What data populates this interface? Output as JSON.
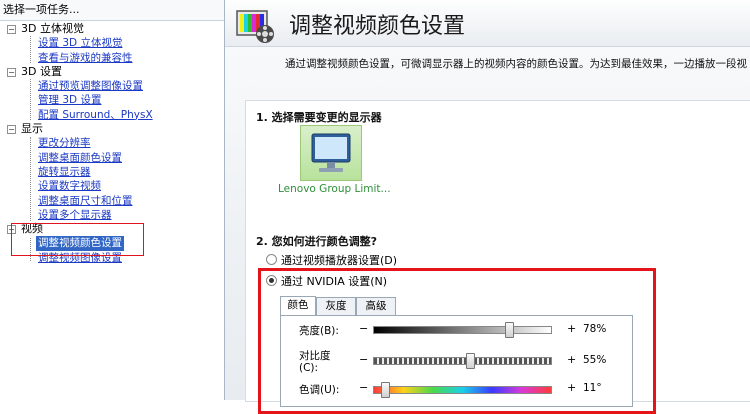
{
  "task_pane": {
    "header": "选择一项任务...",
    "categories": [
      {
        "label": "3D 立体视觉",
        "items": [
          "设置 3D 立体视觉",
          "查看与游戏的兼容性"
        ]
      },
      {
        "label": "3D 设置",
        "items": [
          "通过预览调整图像设置",
          "管理 3D 设置",
          "配置 Surround、PhysX"
        ]
      },
      {
        "label": "显示",
        "items": [
          "更改分辨率",
          "调整桌面颜色设置",
          "旋转显示器",
          "设置数字视频",
          "调整桌面尺寸和位置",
          "设置多个显示器"
        ]
      },
      {
        "label": "视频",
        "items": [
          "调整视频颜色设置",
          "调整视频图像设置"
        ]
      }
    ],
    "expander_symbol": "−"
  },
  "page": {
    "title": "调整视频颜色设置",
    "description": "通过调整视频颜色设置，可微调显示器上的视频内容的颜色设置。为达到最佳效果，一边播放一段视",
    "section1": "1. 选择需要变更的显示器",
    "monitor_name": "Lenovo Group Limit...",
    "section2": "2. 您如何进行颜色调整?",
    "radio_player": "通过视频播放器设置(D)",
    "radio_nvidia": "通过 NVIDIA 设置(N)",
    "tabs": [
      "颜色",
      "灰度",
      "高级"
    ],
    "sliders": [
      {
        "label": "亮度(B):",
        "minus": "−",
        "plus": "+",
        "value": "78%",
        "position": 0.78
      },
      {
        "label": "对比度(C):",
        "minus": "−",
        "plus": "+",
        "value": "55%",
        "position": 0.55
      },
      {
        "label": "色调(U):",
        "minus": "−",
        "plus": "+",
        "value": "11°",
        "position": 0.04
      }
    ]
  },
  "colors": {
    "highlight": "#e5141b",
    "link": "#1b39c4",
    "selection": "#3166c5",
    "monitor_text": "#2e8f3a"
  }
}
